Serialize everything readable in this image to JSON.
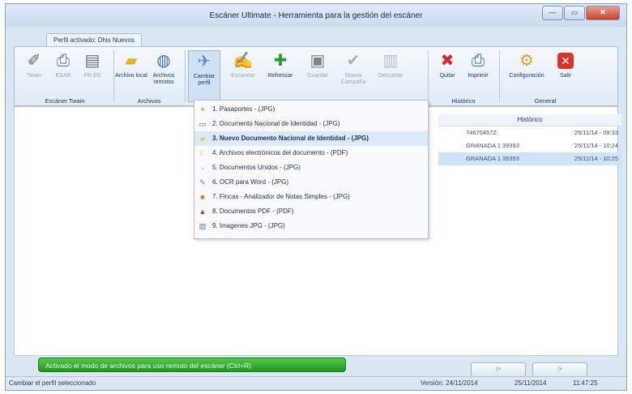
{
  "window": {
    "title": "Escáner Ultimate - Herramienta para la gestión del escáner"
  },
  "profile_tab": "Perfil activado: Dhis Nuevos",
  "ribbon": {
    "buttons": [
      {
        "label": "Twain",
        "icon": "scanner-icon"
      },
      {
        "label": "ESAR",
        "icon": "printer-icon"
      },
      {
        "label": "FR.BS",
        "icon": "fax-icon"
      },
      {
        "label": "Archivo local",
        "icon": "folder-icon"
      },
      {
        "label": "Archivos remotos",
        "icon": "remote-folder-icon"
      },
      {
        "label": "Cambiar perfil",
        "icon": "profile-icon"
      },
      {
        "label": "Escanear",
        "icon": "scan-icon"
      },
      {
        "label": "Refrescar",
        "icon": "refresh-icon"
      },
      {
        "label": "Guardar",
        "icon": "save-icon"
      },
      {
        "label": "Nueva Campaña",
        "icon": "check-icon"
      },
      {
        "label": "Descartar",
        "icon": "trash-icon"
      },
      {
        "label": "Quitar",
        "icon": "remove-icon"
      },
      {
        "label": "Imprimir",
        "icon": "print-icon"
      },
      {
        "label": "Configuración",
        "icon": "settings-icon"
      },
      {
        "label": "Salir",
        "icon": "exit-icon"
      }
    ],
    "groups": [
      "Escáner Twain",
      "Archivos",
      "Histórico",
      "General"
    ]
  },
  "profile_menu": [
    {
      "label": "1. Pasaportes - (JPG)",
      "icon": "passport-icon"
    },
    {
      "label": "2. Documento Nacional de Identidad - (JPG)",
      "icon": "id-card-icon"
    },
    {
      "label": "3. Nuevo Documento Nacional de Identidad - (JPG)",
      "icon": "new-id-card-icon"
    },
    {
      "label": "4. Archivos electrónicos del documento - (PDF)",
      "icon": "electronic-doc-icon"
    },
    {
      "label": "5. Documentos Unidos - (JPG)",
      "icon": "joined-docs-icon"
    },
    {
      "label": "6. OCR para Word - (JPG)",
      "icon": "ocr-icon"
    },
    {
      "label": "7. Fincas - Analizador de Notas Simples - (JPG)",
      "icon": "property-icon"
    },
    {
      "label": "8. Documentos PDF - (PDF)",
      "icon": "pdf-icon"
    },
    {
      "label": "9. Imagenes JPG - (JPG)",
      "icon": "image-icon"
    }
  ],
  "history": {
    "header": "Histórico",
    "rows": [
      {
        "name": "74670457Z",
        "date": "25/11/14 - 09:33"
      },
      {
        "name": "GRANADA 1 39393",
        "date": "25/11/14 - 10:24"
      },
      {
        "name": "GRANADA 1 39393",
        "date": "25/11/14 - 10:25"
      }
    ]
  },
  "banner": "Activado el modo de archivos para uso remoto del escáner (Ctrl+R)",
  "status": {
    "left": "Cambiar el perfil seleccionado",
    "version": "Versión: 24/11/2014",
    "date": "25/11/2014",
    "time": "11:47:25"
  },
  "colors": {
    "accent": "#1b3a7a",
    "banner": "#2fa82b",
    "highlight": "#dbe9f8"
  }
}
